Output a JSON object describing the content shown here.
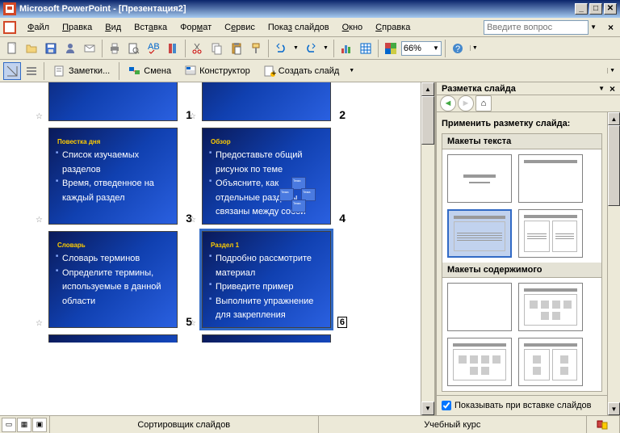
{
  "title": "Microsoft PowerPoint - [Презентация2]",
  "menu": {
    "file": "Файл",
    "edit": "Правка",
    "view": "Вид",
    "insert": "Вставка",
    "format": "Формат",
    "tools": "Сервис",
    "slideshow": "Показ слайдов",
    "window": "Окно",
    "help": "Справка"
  },
  "question_placeholder": "Введите вопрос",
  "zoom": "66%",
  "toolbar2": {
    "notes": "Заметки...",
    "transition": "Смена",
    "designer": "Конструктор",
    "newslide": "Создать слайд"
  },
  "slides": [
    {
      "num": "1",
      "title": "",
      "lines": []
    },
    {
      "num": "2",
      "title": "",
      "lines": []
    },
    {
      "num": "3",
      "title": "Повестка дня",
      "lines": [
        "Список изучаемых разделов",
        "Время, отведенное на каждый раздел"
      ]
    },
    {
      "num": "4",
      "title": "Обзор",
      "lines": [
        "Предоставьте общий рисунок по теме",
        "Объясните, как отдельные разделы связаны между собой"
      ]
    },
    {
      "num": "5",
      "title": "Словарь",
      "lines": [
        "Словарь терминов",
        "Определите термины, используемые в данной области"
      ]
    },
    {
      "num": "6",
      "title": "Раздел 1",
      "lines": [
        "Подробно рассмотрите материал",
        "Приведите пример",
        "Выполните упражнение для закрепления материала"
      ],
      "selected": true
    }
  ],
  "taskpane": {
    "title": "Разметка слайда",
    "apply": "Применить разметку слайда:",
    "section1": "Макеты текста",
    "section2": "Макеты содержимого",
    "checkbox": "Показывать при вставке слайдов"
  },
  "status": {
    "view": "Сортировщик слайдов",
    "course": "Учебный курс"
  }
}
